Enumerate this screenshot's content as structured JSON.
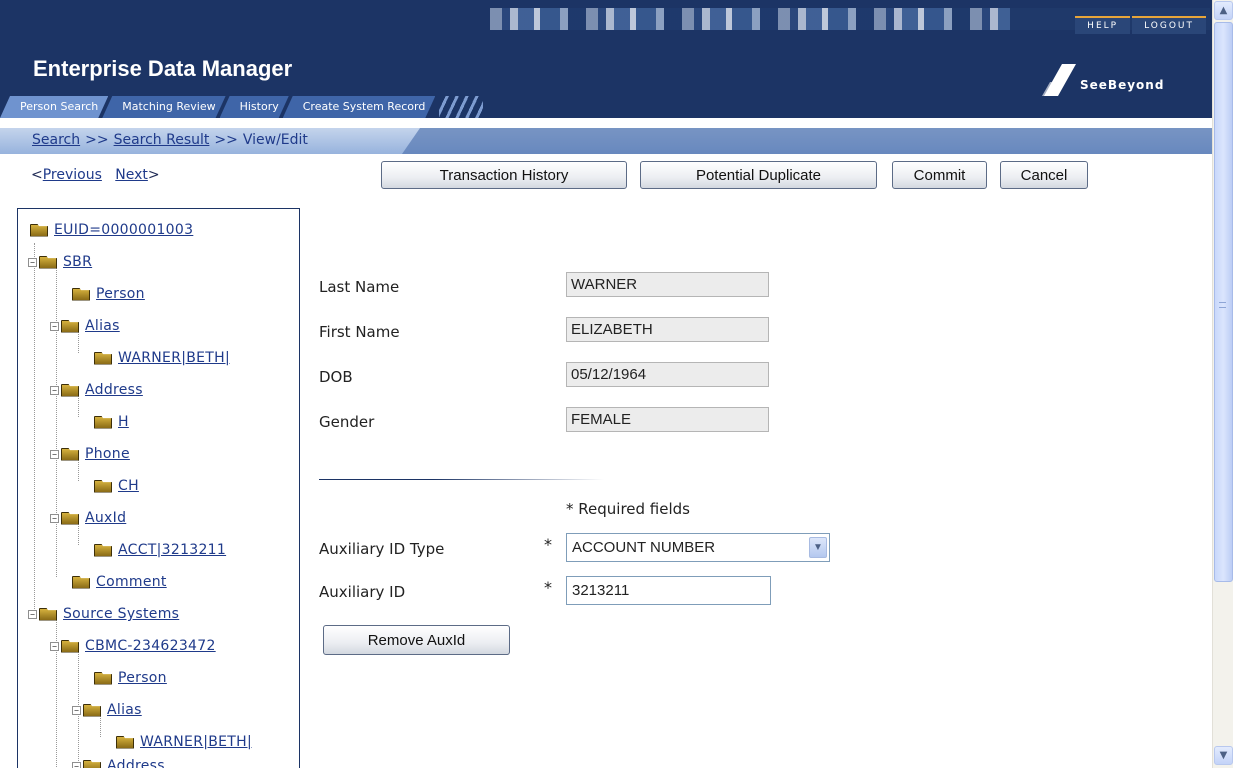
{
  "header": {
    "app_title": "Enterprise Data Manager",
    "help_label": "HELP",
    "logout_label": "LOGOUT",
    "logo_text": "SeeBeyond",
    "tabs": [
      {
        "label": "Person Search",
        "active": true
      },
      {
        "label": "Matching Review",
        "active": false
      },
      {
        "label": "History",
        "active": false
      },
      {
        "label": "Create System Record",
        "active": false
      }
    ]
  },
  "breadcrumb": {
    "search": "Search",
    "search_result": "Search Result",
    "current": "View/Edit",
    "separator": ">>"
  },
  "nav": {
    "previous_prefix": "<",
    "previous": "Previous",
    "next": "Next",
    "next_suffix": ">"
  },
  "toolbar": {
    "transaction_history": "Transaction History",
    "potential_duplicate": "Potential Duplicate",
    "commit": "Commit",
    "cancel": "Cancel"
  },
  "tree": {
    "items": [
      {
        "label": "EUID=0000001003"
      },
      {
        "label": "SBR"
      },
      {
        "label": "Person"
      },
      {
        "label": "Alias"
      },
      {
        "label": "WARNER|BETH|"
      },
      {
        "label": "Address"
      },
      {
        "label": "H"
      },
      {
        "label": "Phone"
      },
      {
        "label": "CH"
      },
      {
        "label": "AuxId"
      },
      {
        "label": "ACCT|3213211"
      },
      {
        "label": "Comment"
      },
      {
        "label": "Source Systems"
      },
      {
        "label": "CBMC-234623472"
      },
      {
        "label": "Person"
      },
      {
        "label": "Alias"
      },
      {
        "label": "WARNER|BETH|"
      },
      {
        "label": "Address"
      }
    ]
  },
  "form": {
    "last_name_label": "Last Name",
    "last_name_value": "WARNER",
    "first_name_label": "First Name",
    "first_name_value": "ELIZABETH",
    "dob_label": "DOB",
    "dob_value": "05/12/1964",
    "gender_label": "Gender",
    "gender_value": "FEMALE",
    "required_note": "* Required fields",
    "required_marker": "*",
    "aux_type_label": "Auxiliary ID Type",
    "aux_type_value": "ACCOUNT NUMBER",
    "aux_id_label": "Auxiliary ID",
    "aux_id_value": "3213211",
    "remove_button": "Remove AuxId"
  },
  "icons": {
    "folder": "folder-icon",
    "tree_toggle": "minus-box-icon",
    "scroll_up": "chevron-up-icon",
    "scroll_down": "chevron-down-icon",
    "select_arrow": "chevron-down-icon"
  },
  "colors": {
    "header_bg": "#1c3465",
    "tab_active": "#6f93cf",
    "tab": "#3f65a8",
    "link": "#1f3a8a",
    "accent": "#e7a53a"
  }
}
